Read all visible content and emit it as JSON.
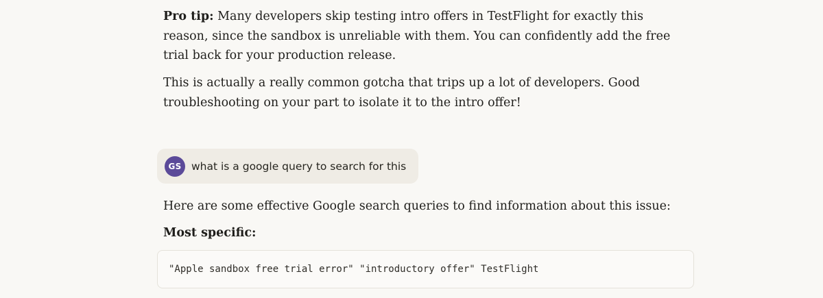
{
  "messages": {
    "pro_tip_label": "Pro tip:",
    "pro_tip_text": " Many developers skip testing intro offers in TestFlight for exactly this reason, since the sandbox is unreliable with them. You can confidently add the free trial back for your production release.",
    "closing_text": "This is actually a really common gotcha that trips up a lot of developers. Good troubleshooting on your part to isolate it to the intro offer!",
    "user": {
      "avatar_initials": "GS",
      "text": "what is a google query to search for this"
    },
    "reply_intro": "Here are some effective Google search queries to find information about this issue:",
    "reply_heading": "Most specific:",
    "code_query": "\"Apple sandbox free trial error\" \"introductory offer\" TestFlight"
  },
  "colors": {
    "background": "#f9f8f5",
    "user_bubble": "#efece5",
    "avatar": "#5b4a99",
    "code_background": "#fbfaf8"
  }
}
